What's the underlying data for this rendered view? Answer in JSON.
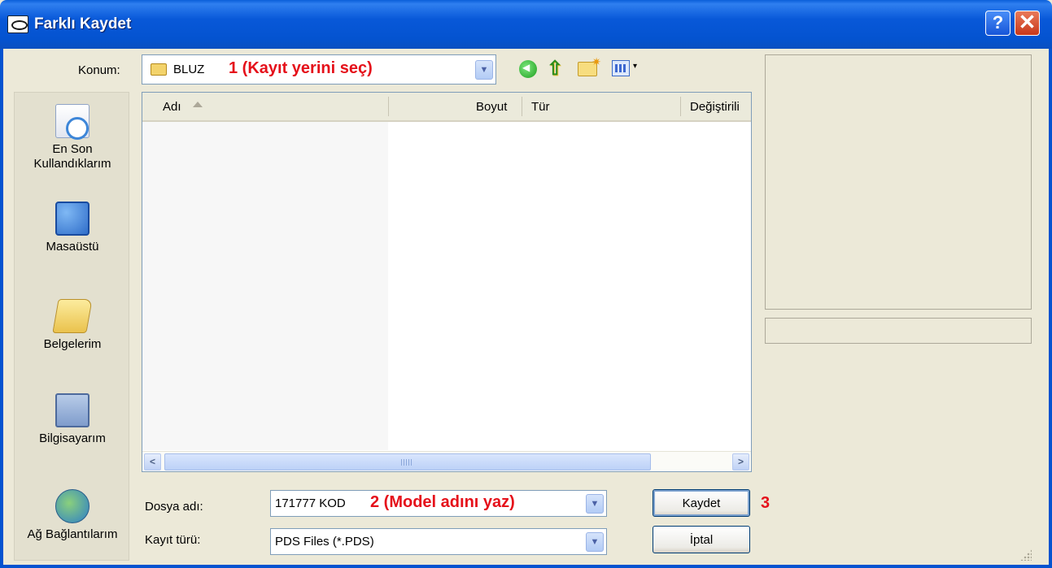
{
  "window": {
    "title": "Farklı Kaydet",
    "help_label": "?",
    "close_label": "✕"
  },
  "location": {
    "label": "Konum:",
    "value": "BLUZ",
    "note": "1 (Kayıt yerini seç)",
    "dropdown_glyph": "▼"
  },
  "places": [
    {
      "label": "En Son Kullandıklarım",
      "icon": "recent-documents-icon"
    },
    {
      "label": "Masaüstü",
      "icon": "desktop-icon"
    },
    {
      "label": "Belgelerim",
      "icon": "my-documents-icon"
    },
    {
      "label": "Bilgisayarım",
      "icon": "my-computer-icon"
    },
    {
      "label": "Ağ Bağlantılarım",
      "icon": "network-places-icon"
    }
  ],
  "file_list": {
    "columns": {
      "name": "Adı",
      "size": "Boyut",
      "type": "Tür",
      "modified": "Değiştirili"
    },
    "rows": []
  },
  "form": {
    "filename_label": "Dosya adı:",
    "filename_value": "171777 KOD",
    "filename_note": "2 (Model adını yaz)",
    "filetype_label": "Kayıt türü:",
    "filetype_value": "PDS Files (*.PDS)",
    "dropdown_glyph": "▼"
  },
  "buttons": {
    "save": "Kaydet",
    "cancel": "İptal",
    "save_note": "3"
  },
  "scrollbar": {
    "left_glyph": "<",
    "right_glyph": ">"
  }
}
